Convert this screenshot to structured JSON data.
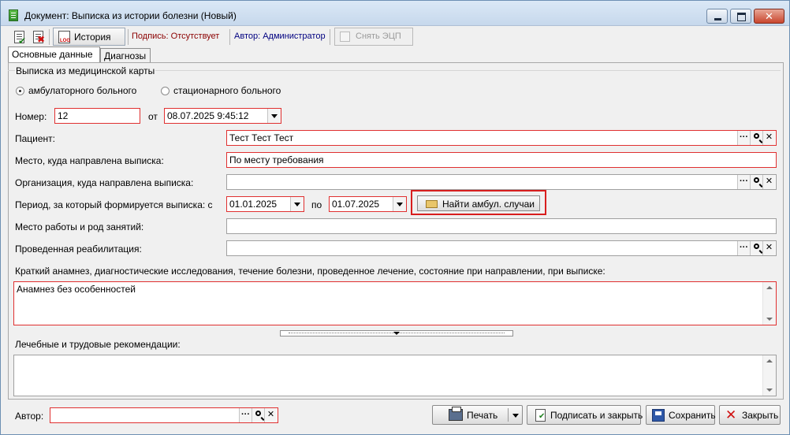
{
  "window": {
    "title": "Документ: Выписка из истории болезни (Новый)",
    "close_glyph": "✕"
  },
  "toolbar": {
    "history_label": "История",
    "signature_label": "Подпись: Отсутствует",
    "author_label": "Автор: Администратор",
    "remove_ecp_label": "Снять ЭЦП"
  },
  "tabs": [
    {
      "label": "Основные данные",
      "active": true
    },
    {
      "label": "Диагнозы",
      "active": false
    }
  ],
  "card_group": {
    "legend": "Выписка из медицинской карты",
    "options": [
      {
        "label": "амбулаторного больного",
        "selected": true
      },
      {
        "label": "стационарного больного",
        "selected": false
      }
    ]
  },
  "form": {
    "number_label": "Номер:",
    "number_value": "12",
    "date_from_label": "от",
    "date_value": "08.07.2025 9:45:12",
    "patient_label": "Пациент:",
    "patient_value": "Тест Тест Тест",
    "place_label": "Место, куда направлена выписка:",
    "place_value": "По месту требования",
    "org_label": "Организация, куда направлена выписка:",
    "org_value": "",
    "period_label": "Период, за который формируется выписка: с",
    "period_from": "01.01.2025",
    "period_to_label": "по",
    "period_to": "01.07.2025",
    "find_button": "Найти амбул. случаи",
    "work_label": "Место работы и род занятий:",
    "work_value": "",
    "rehab_label": "Проведенная реабилитация:",
    "rehab_value": "",
    "anamnesis_label": "Краткий анамнез, диагностические исследования, течение болезни, проведенное лечение, состояние при направлении, при выписке:",
    "anamnesis_value": "Анамнез без особенностей",
    "recommend_label": "Лечебные и трудовые рекомендации:",
    "recommend_value": "",
    "edit_buttons": {
      "more": "···",
      "clear": "✕"
    }
  },
  "footer": {
    "author_label": "Автор:",
    "author_value": "",
    "print_label": "Печать",
    "sign_close_label": "Подписать и закрыть",
    "save_label": "Сохранить",
    "close_label": "Закрыть",
    "close_glyph": "✕"
  }
}
